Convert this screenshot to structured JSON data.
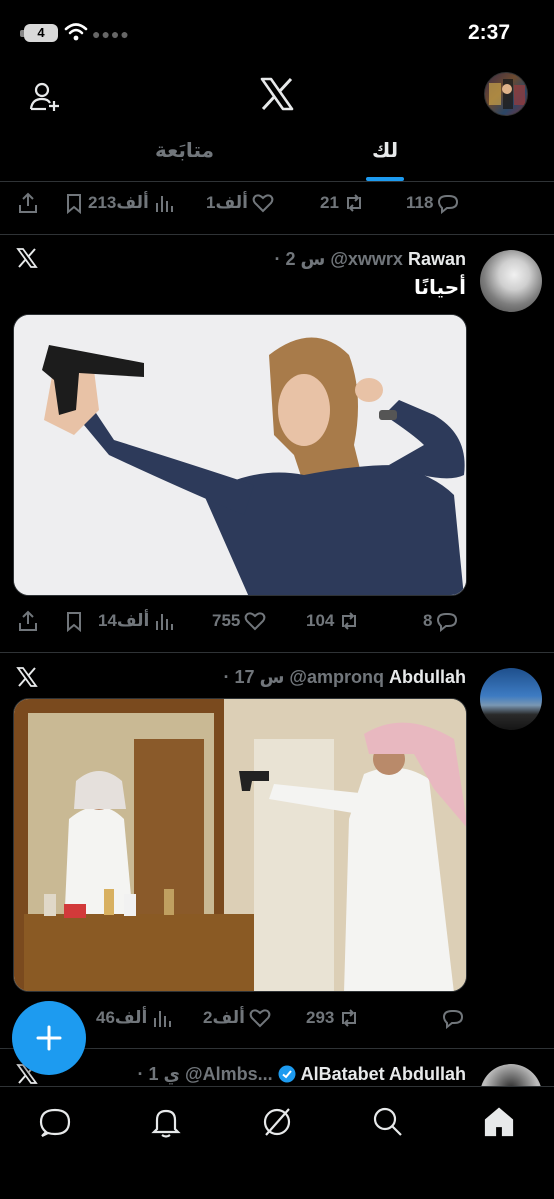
{
  "status_bar": {
    "battery": "4",
    "time": "2:37"
  },
  "tabs": [
    {
      "label": "متابَعة",
      "active": false
    },
    {
      "label": "لك",
      "active": true
    }
  ],
  "top_actions": {
    "replies": "118",
    "reposts": "21",
    "likes": "1ألف",
    "views": "213ألف"
  },
  "tweets": [
    {
      "name": "Rawan",
      "handle": "@xwwrx",
      "time": "· 2 س",
      "text": "أحيانًا",
      "media_icon": "woman-holding-pistol-photo",
      "actions": {
        "replies": "8",
        "reposts": "104",
        "likes": "755",
        "views": "14ألف"
      }
    },
    {
      "name": "Abdullah",
      "handle": "@ampronq",
      "time": "· 17 س",
      "text": "",
      "media_icon": "man-aiming-at-mirror-photo",
      "actions": {
        "replies": "",
        "reposts": "293",
        "likes": "2ألف",
        "views": "46ألف"
      }
    },
    {
      "name": "AlBatabet Abdullah",
      "handle": "@Almbs...",
      "time": "· 1 ي",
      "verified": true
    }
  ],
  "colors": {
    "accent": "#1d9bf0",
    "muted": "#71767b",
    "background": "#000000"
  }
}
